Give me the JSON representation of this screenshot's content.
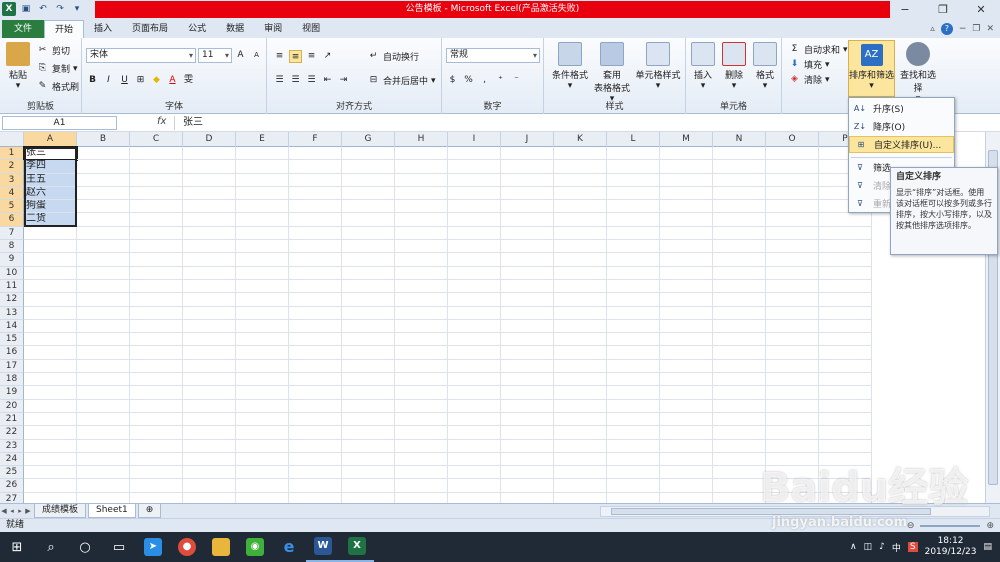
{
  "title": "公告模板 - Microsoft Excel(产品激活失败)",
  "tabs": [
    "文件",
    "开始",
    "插入",
    "页面布局",
    "公式",
    "数据",
    "审阅",
    "视图"
  ],
  "ribbon": {
    "clipboard": {
      "label": "剪贴板",
      "paste": "粘贴",
      "cut": "剪切",
      "copy": "复制",
      "format_painter": "格式刷"
    },
    "font": {
      "label": "字体",
      "name": "宋体",
      "size": "11",
      "bold": "B",
      "italic": "I",
      "underline": "U",
      "wen": "雯"
    },
    "align": {
      "label": "对齐方式",
      "wrap": "自动换行",
      "merge": "合并后居中"
    },
    "number": {
      "label": "数字",
      "format": "常规",
      "percent": "%"
    },
    "styles": {
      "label": "样式",
      "cond": "条件格式",
      "table1": "套用",
      "table2": "表格格式",
      "cell": "单元格样式"
    },
    "cells": {
      "label": "单元格",
      "insert": "插入",
      "delete": "删除",
      "format": "格式"
    },
    "edit": {
      "autosum": "自动求和",
      "fill": "填充",
      "clear": "清除",
      "sort": "排序和筛选",
      "find": "查找和选择"
    }
  },
  "namebox": "A1",
  "formula": "张三",
  "columns": [
    "A",
    "B",
    "C",
    "D",
    "E",
    "F",
    "G",
    "H",
    "I",
    "J",
    "K",
    "L",
    "M",
    "N",
    "O",
    "P"
  ],
  "rows": 27,
  "cells_a": [
    "张三",
    "李四",
    "王五",
    "赵六",
    "狗蛋",
    "二货"
  ],
  "sheets": [
    "成绩模板",
    "Sheet1"
  ],
  "status": "就绪",
  "sort_menu": {
    "asc": "升序(S)",
    "desc": "降序(O)",
    "custom": "自定义排序(U)...",
    "filter": "筛选",
    "clear": "清除",
    "reapply": "重新"
  },
  "tooltip": {
    "title": "自定义排序",
    "body": "显示“排序”对话框。使用该对话框可以按多列或多行排序，按大小写排序，以及按其他排序选项排序。"
  },
  "taskbar": {
    "time": "18:12",
    "date": "2019/12/23",
    "ime": "中"
  },
  "watermark": {
    "main": "Baidu经验",
    "sub": "jingyan.baidu.com"
  }
}
